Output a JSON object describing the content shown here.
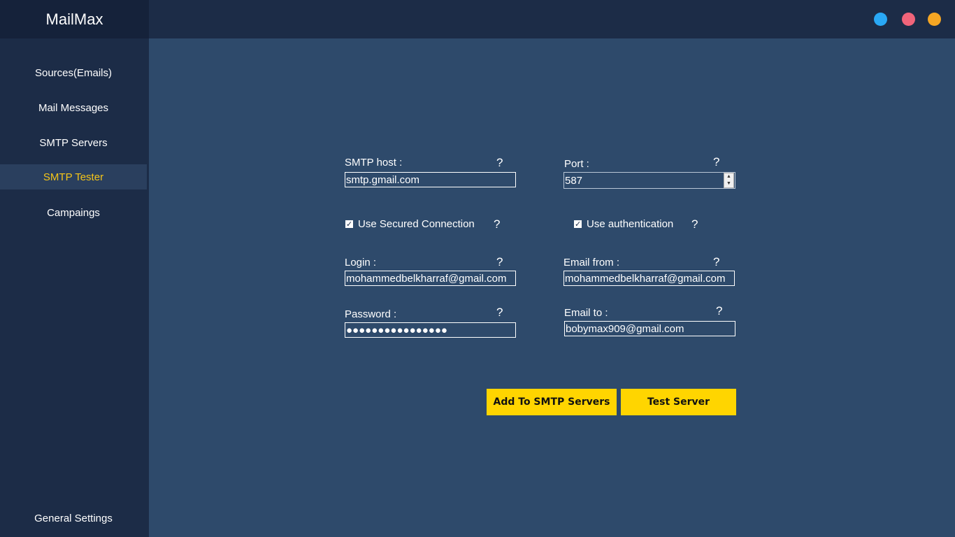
{
  "app": {
    "title": "MailMax"
  },
  "sidebar": {
    "items": [
      {
        "label": "Sources(Emails)"
      },
      {
        "label": "Mail Messages"
      },
      {
        "label": "SMTP Servers"
      },
      {
        "label": "SMTP Tester",
        "active": true
      },
      {
        "label": "Campaings"
      }
    ],
    "footer_label": "General Settings"
  },
  "window_controls": {
    "colors": [
      "#29a8f5",
      "#f0647a",
      "#f5a623"
    ]
  },
  "form": {
    "smtp_host": {
      "label": "SMTP host :",
      "value": "smtp.gmail.com",
      "help": "?"
    },
    "port": {
      "label": "Port :",
      "value": "587",
      "help": "?"
    },
    "secured": {
      "label": "Use Secured Connection",
      "checked": true,
      "help": "?"
    },
    "auth": {
      "label": "Use authentication",
      "checked": true,
      "help": "?"
    },
    "login": {
      "label": "Login :",
      "value": "mohammedbelkharraf@gmail.com",
      "help": "?"
    },
    "email_from": {
      "label": "Email from :",
      "value": "mohammedbelkharraf@gmail.com",
      "help": "?"
    },
    "password": {
      "label": "Password :",
      "value": "●●●●●●●●●●●●●●●●",
      "help": "?"
    },
    "email_to": {
      "label": "Email to :",
      "value": "bobymax909@gmail.com",
      "help": "?"
    }
  },
  "actions": {
    "add_label": "Add To SMTP Servers",
    "test_label": "Test Server"
  },
  "colors": {
    "accent": "#ffd500",
    "active_nav": "#f5c518",
    "background": "#2e4a6b",
    "sidebar": "#1c2c47"
  }
}
